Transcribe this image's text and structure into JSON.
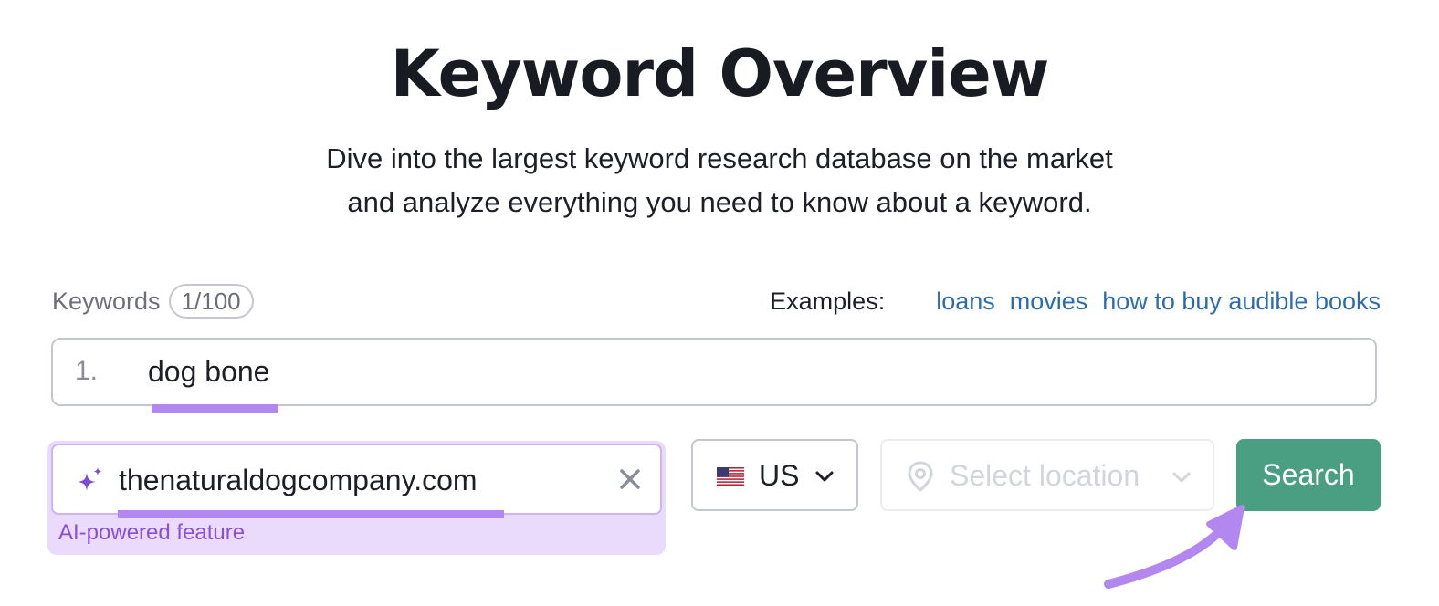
{
  "header": {
    "title": "Keyword Overview",
    "subtitle_line1": "Dive into the largest keyword research database on the market",
    "subtitle_line2": "and analyze everything you need to know about a keyword."
  },
  "keywords": {
    "label": "Keywords",
    "counter": "1/100",
    "examples_label": "Examples:",
    "examples": [
      "loans",
      "movies",
      "how to buy audible books"
    ],
    "entries": [
      {
        "number": "1.",
        "value": "dog bone"
      }
    ]
  },
  "domain_input": {
    "value": "thenaturaldogcompany.com",
    "caption": "AI-powered feature",
    "icon": "sparkle-icon",
    "clear_icon": "close-icon"
  },
  "country_select": {
    "flag_icon": "us-flag-icon",
    "value": "US",
    "chevron_icon": "chevron-down-icon"
  },
  "location_select": {
    "placeholder": "Select location",
    "icon": "location-pin-icon",
    "chevron_icon": "chevron-down-icon"
  },
  "search_button": {
    "label": "Search"
  },
  "colors": {
    "accent_purple": "#b387f0",
    "ai_background": "#eadbfd",
    "search_green": "#4a9e82",
    "link_blue": "#2b6cb0"
  }
}
